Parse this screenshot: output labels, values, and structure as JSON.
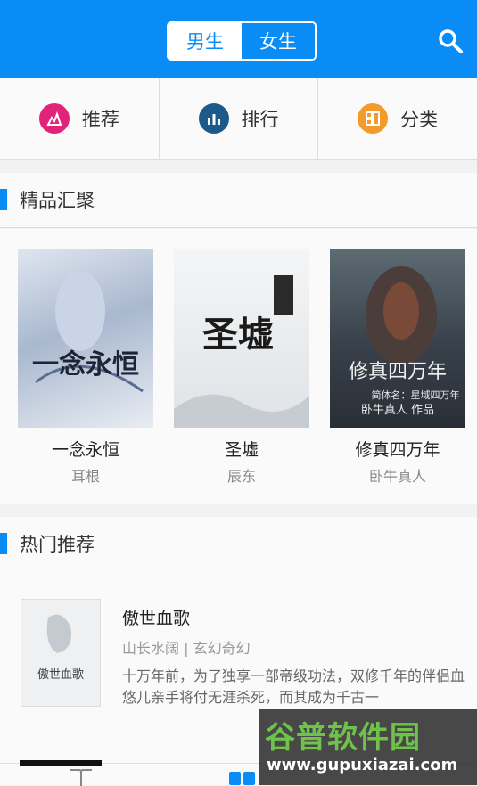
{
  "header": {
    "tabs": [
      {
        "label": "男生",
        "active": true
      },
      {
        "label": "女生",
        "active": false
      }
    ],
    "search_icon": "search-icon",
    "colors": {
      "accent": "#0a8cf7"
    }
  },
  "nav": [
    {
      "label": "推荐",
      "icon": "flame-icon",
      "color": "#e2237a"
    },
    {
      "label": "排行",
      "icon": "bar-chart-icon",
      "color": "#1d5a8a"
    },
    {
      "label": "分类",
      "icon": "category-grid-icon",
      "color": "#f39a2c"
    }
  ],
  "featured": {
    "title": "精品汇聚",
    "books": [
      {
        "title": "一念永恒",
        "author": "耳根"
      },
      {
        "title": "圣墟",
        "author": "辰东"
      },
      {
        "title": "修真四万年",
        "author": "卧牛真人"
      }
    ]
  },
  "hot": {
    "title": "热门推荐",
    "item": {
      "title": "傲世血歌",
      "meta": "山长水阔 | 玄幻奇幻",
      "desc": "十万年前，为了独享一部帝级功法，双修千年的伴侣血悠儿亲手将付无涯杀死，而其成为千古一",
      "cover_text": "傲世血歌"
    }
  },
  "covers": {
    "book1_text": "一念永恒",
    "book2_text": "圣墟",
    "book3_text": "修真四万年",
    "book3_sub": "简体名：星域四万年",
    "book3_author": "卧牛真人 作品"
  },
  "watermark": {
    "line1": "谷普软件园",
    "line2": "www.gupuxiazai.com"
  }
}
